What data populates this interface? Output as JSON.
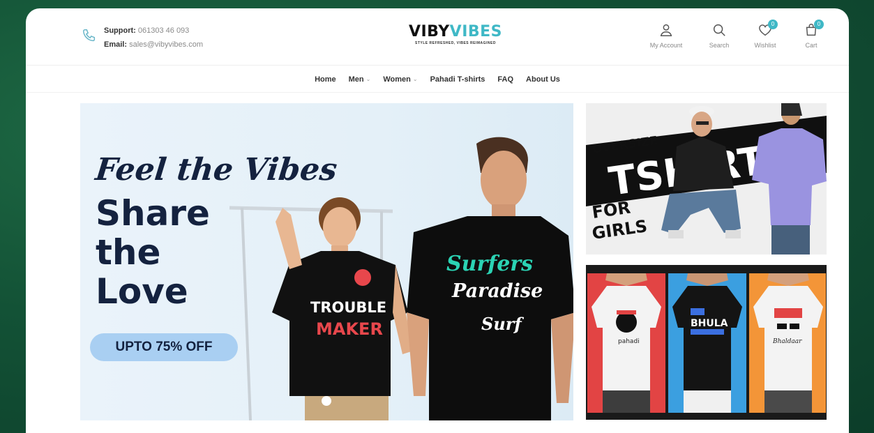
{
  "header": {
    "support_label": "Support:",
    "support_value": "061303 46 093",
    "email_label": "Email:",
    "email_value": "sales@vibyvibes.com",
    "logo_part1": "VIBY",
    "logo_part2": "VIBES",
    "logo_tagline": "STYLE REFRESHED, VIBES REIMAGINED",
    "icons": [
      {
        "label": "My Account",
        "icon": "user-icon"
      },
      {
        "label": "Search",
        "icon": "search-icon"
      },
      {
        "label": "Wishlist",
        "icon": "heart-icon",
        "badge": "0"
      },
      {
        "label": "Cart",
        "icon": "bag-icon",
        "badge": "0"
      }
    ]
  },
  "nav": {
    "items": [
      {
        "label": "Home"
      },
      {
        "label": "Men"
      },
      {
        "label": "Women"
      },
      {
        "label": "Pahadi T-shirts"
      },
      {
        "label": "FAQ"
      },
      {
        "label": "About Us"
      }
    ]
  },
  "hero": {
    "script_text": "Feel the Vibes",
    "line1": "Share",
    "line2": "the",
    "line3": "Love",
    "offer": "UPTO 75% OFF",
    "shirt1_text1": "TROUBLE",
    "shirt1_text2": "MAKER",
    "shirt2_text1": "Surfers",
    "shirt2_text2": "Paradise",
    "shirt2_text3": "Surf"
  },
  "promo1": {
    "line1": "OVERSIZE",
    "line2": "TSHIRT",
    "line3": "FOR",
    "line4": "GIRLS"
  },
  "promo2": {
    "shirt_left": "pahadi",
    "shirt_middle": "BHULA",
    "shirt_right": "Bhaldaar"
  },
  "colors": {
    "accent": "#3fb8c6",
    "navy": "#14223f",
    "offer_pill": "#a9cff2",
    "page_bg": "#135236"
  }
}
